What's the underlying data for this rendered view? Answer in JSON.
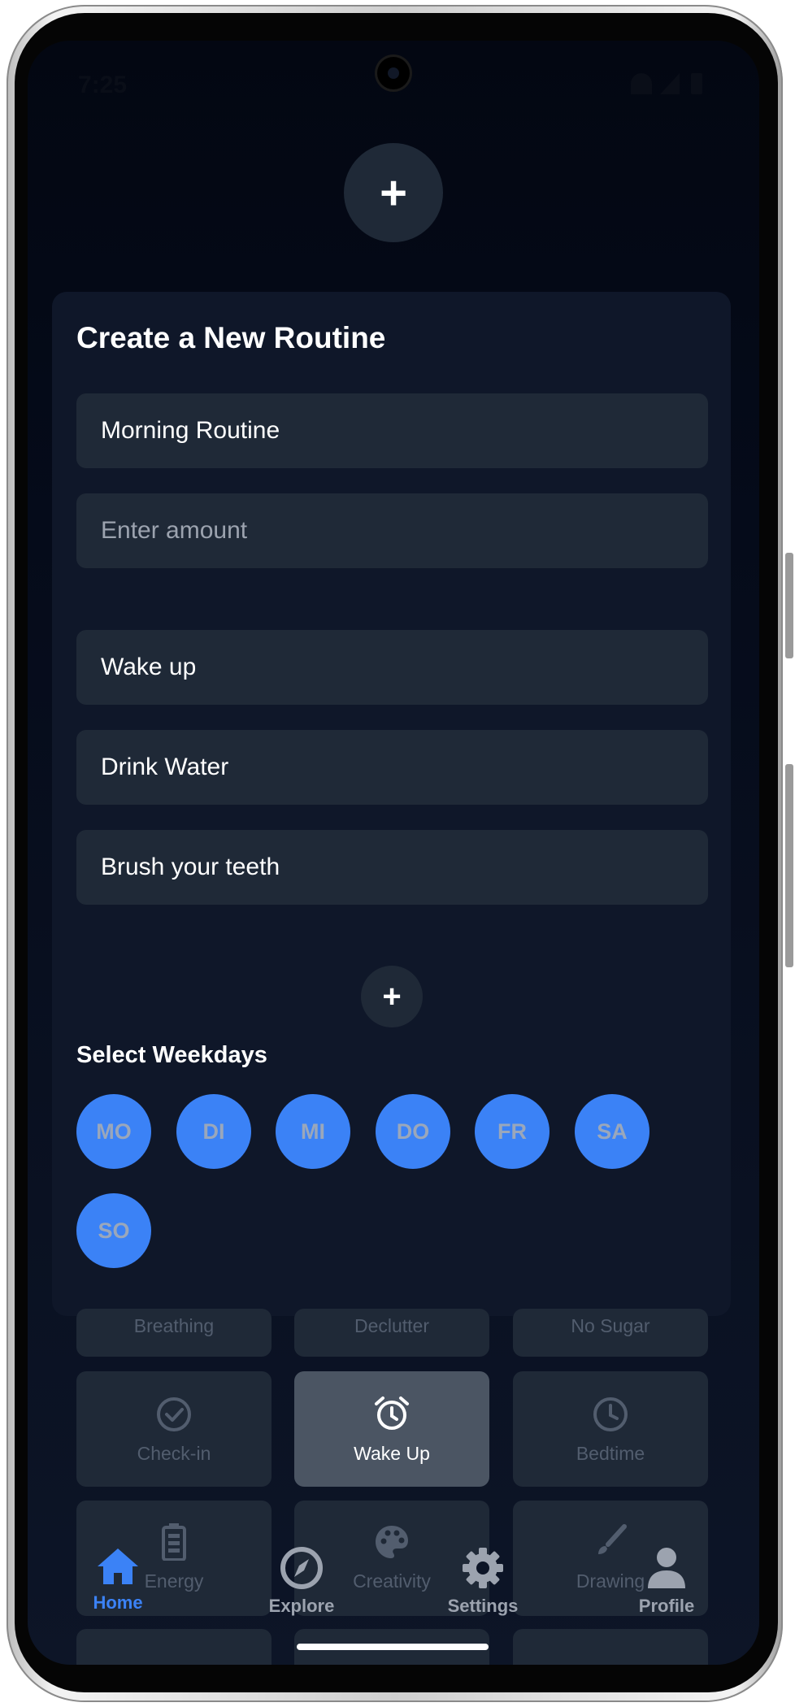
{
  "status_bar": {
    "time": "7:25"
  },
  "top_add_label": "+",
  "form": {
    "title": "Create a New Routine",
    "name_value": "Morning Routine",
    "amount_placeholder": "Enter amount",
    "steps": [
      "Wake up",
      "Drink Water",
      "Brush your teeth"
    ],
    "add_step_label": "+",
    "weekdays_label": "Select Weekdays",
    "weekdays": [
      "MO",
      "DI",
      "MI",
      "DO",
      "FR",
      "SA",
      "SO"
    ]
  },
  "activities": {
    "partial_row": [
      "Breathing",
      "Declutter",
      "No Sugar"
    ],
    "row2": [
      {
        "label": "Check-in",
        "icon": "check-circle-icon"
      },
      {
        "label": "Wake Up",
        "icon": "alarm-clock-icon",
        "selected": true
      },
      {
        "label": "Bedtime",
        "icon": "clock-icon"
      }
    ],
    "row3": [
      {
        "label": "Energy",
        "icon": "battery-icon"
      },
      {
        "label": "Creativity",
        "icon": "palette-icon"
      },
      {
        "label": "Drawing",
        "icon": "brush-icon"
      }
    ]
  },
  "nav": [
    {
      "label": "Home",
      "icon": "home-icon",
      "active": true
    },
    {
      "label": "Explore",
      "icon": "compass-icon"
    },
    {
      "label": "Settings",
      "icon": "gear-icon"
    },
    {
      "label": "Profile",
      "icon": "person-icon"
    }
  ],
  "colors": {
    "accent": "#3b82f6",
    "background": "#030712",
    "card": "#0f1729",
    "field": "#1f2937",
    "selected_tile": "#4b5563"
  }
}
